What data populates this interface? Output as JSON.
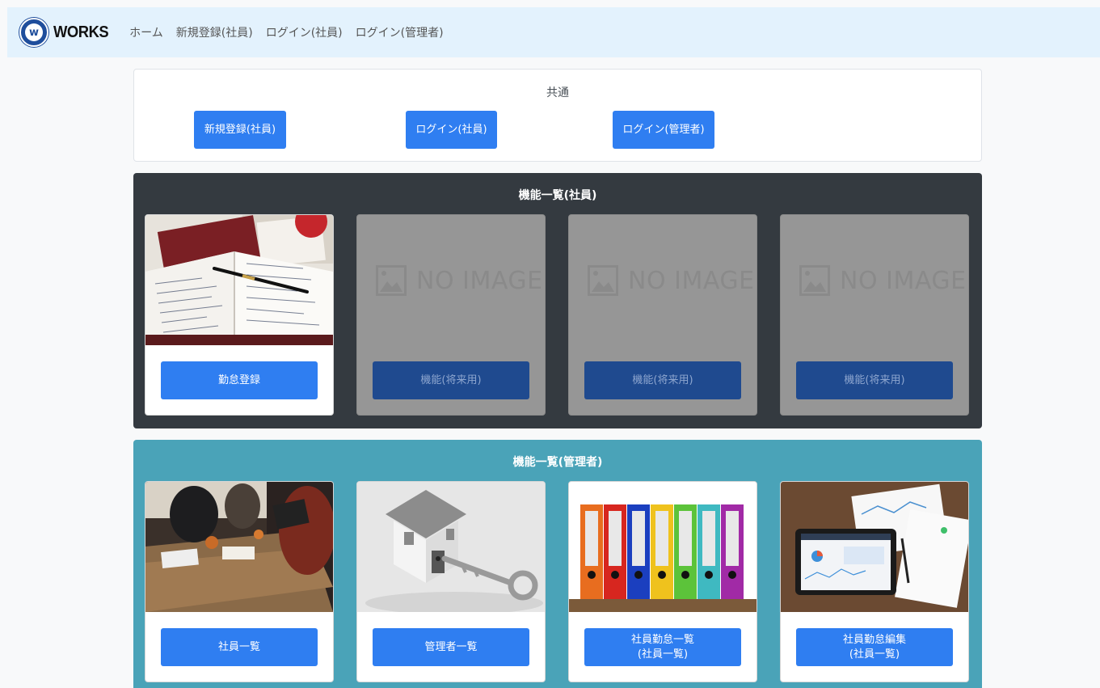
{
  "navbar": {
    "brand": "WORKS",
    "logo_letter": "w",
    "links": [
      "ホーム",
      "新規登録(社員)",
      "ログイン(社員)",
      "ログイン(管理者)"
    ]
  },
  "common": {
    "title": "共通",
    "buttons": [
      "新規登録(社員)",
      "ログイン(社員)",
      "ログイン(管理者)"
    ]
  },
  "employee_section": {
    "title": "機能一覧(社員)",
    "tiles": [
      {
        "label": "勤怠登録",
        "image": "notebook-with-pen-photo"
      },
      {
        "label": "機能(将来用)",
        "image": "no-image-placeholder",
        "placeholder_text": "NO IMAGE"
      },
      {
        "label": "機能(将来用)",
        "image": "no-image-placeholder",
        "placeholder_text": "NO IMAGE"
      },
      {
        "label": "機能(将来用)",
        "image": "no-image-placeholder",
        "placeholder_text": "NO IMAGE"
      }
    ]
  },
  "admin_section": {
    "title": "機能一覧(管理者)",
    "tiles": [
      {
        "label": "社員一覧",
        "image": "meeting-table-photo"
      },
      {
        "label": "管理者一覧",
        "image": "house-with-key-photo"
      },
      {
        "label_line1": "社員勤怠一覧",
        "label_line2": "(社員一覧)",
        "image": "colorful-binders-photo"
      },
      {
        "label_line1": "社員勤怠編集",
        "label_line2": "(社員一覧)",
        "image": "tablet-with-reports-photo"
      }
    ]
  },
  "colors": {
    "navbar_bg": "#e3f2fd",
    "primary_button": "#2f7ef1",
    "dark_panel": "#343a40",
    "teal_panel": "#4aa3b8",
    "disabled_tile": "#969696"
  }
}
